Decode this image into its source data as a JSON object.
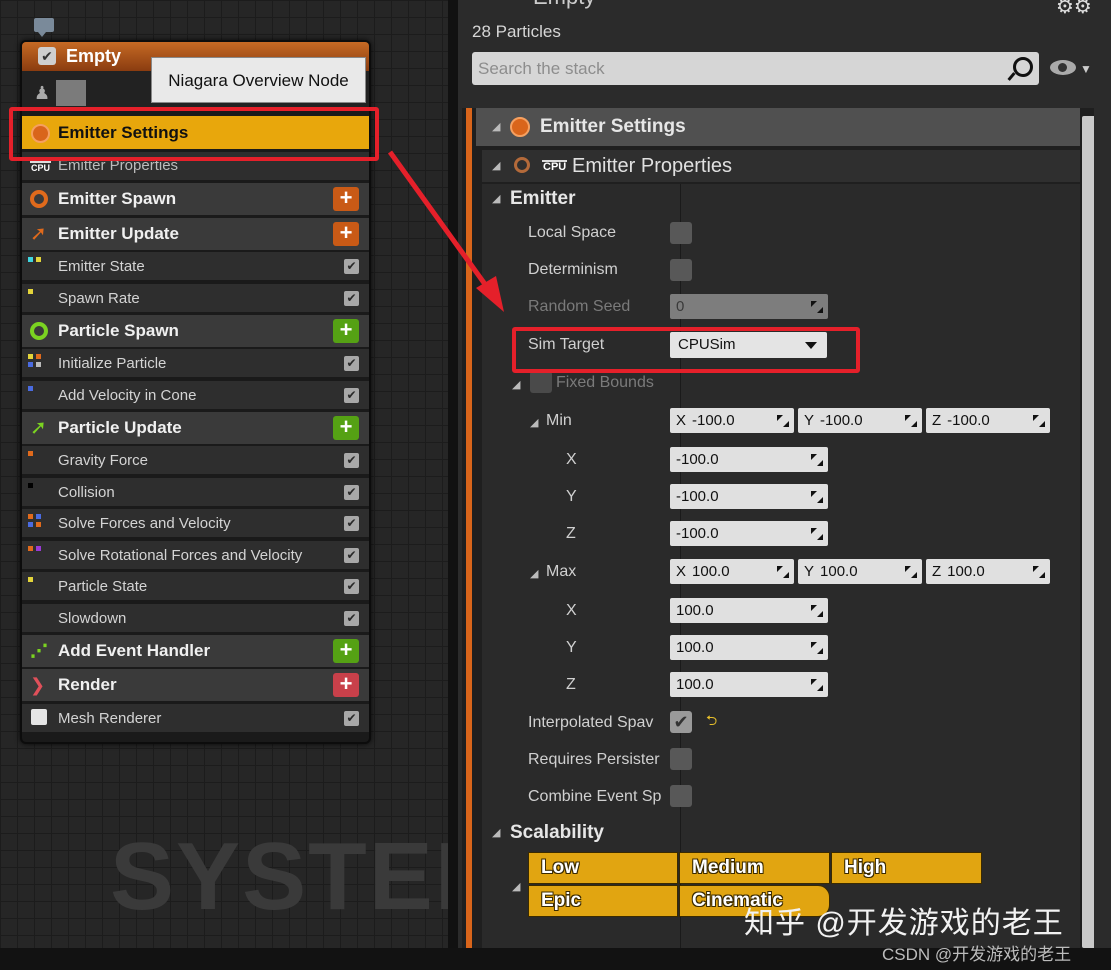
{
  "graph": {
    "watermark": "SYSTEM",
    "tooltip": "Niagara Overview Node",
    "node": {
      "title": "Empty",
      "emitter_settings": "Emitter Settings",
      "emitter_properties": "Emitter Properties",
      "cpu_badge": "CPU",
      "groups": [
        {
          "label": "Emitter Spawn",
          "add_color": "#c95a16"
        },
        {
          "label": "Emitter Update",
          "add_color": "#c95a16"
        },
        {
          "label": "Particle Spawn",
          "add_color": "#55a114"
        },
        {
          "label": "Particle Update",
          "add_color": "#55a114"
        },
        {
          "label": "Add Event Handler",
          "add_color": "#55a114"
        },
        {
          "label": "Render",
          "add_color": "#c8404a"
        }
      ],
      "items": {
        "emitter_state": "Emitter State",
        "spawn_rate": "Spawn Rate",
        "initialize_particle": "Initialize Particle",
        "add_velocity_in_cone": "Add Velocity in Cone",
        "gravity_force": "Gravity Force",
        "collision": "Collision",
        "solve_forces": "Solve Forces and Velocity",
        "solve_rotational": "Solve Rotational Forces and Velocity",
        "particle_state": "Particle State",
        "slowdown": "Slowdown",
        "mesh_renderer": "Mesh Renderer"
      },
      "add_symbol": "+",
      "check_symbol": "✔"
    }
  },
  "panel": {
    "title": "Empty",
    "particle_count": "28 Particles",
    "search_placeholder": "Search the stack",
    "emitter_settings_header": "Emitter Settings",
    "emitter_properties_header": "Emitter Properties",
    "cpu_badge": "CPU",
    "emitter_section": "Emitter",
    "props": {
      "local_space": "Local Space",
      "determinism": "Determinism",
      "random_seed": "Random Seed",
      "random_seed_value": "0",
      "sim_target": "Sim Target",
      "sim_target_value": "CPUSim",
      "fixed_bounds": "Fixed Bounds",
      "min": "Min",
      "max": "Max",
      "x": "X",
      "y": "Y",
      "z": "Z",
      "min_value": "-100.0",
      "max_value": "100.0",
      "interpolated": "Interpolated Spav",
      "requires_persistent": "Requires Persister",
      "combine_event": "Combine Event Sp"
    },
    "scalability_section": "Scalability",
    "scalability_levels": [
      "Low",
      "Medium",
      "High",
      "Epic",
      "Cinematic"
    ],
    "accent_color": "#d9651b"
  },
  "watermarks": {
    "zhihu": "知乎 @开发游戏的老王",
    "csdn": "CSDN @开发游戏的老王"
  }
}
